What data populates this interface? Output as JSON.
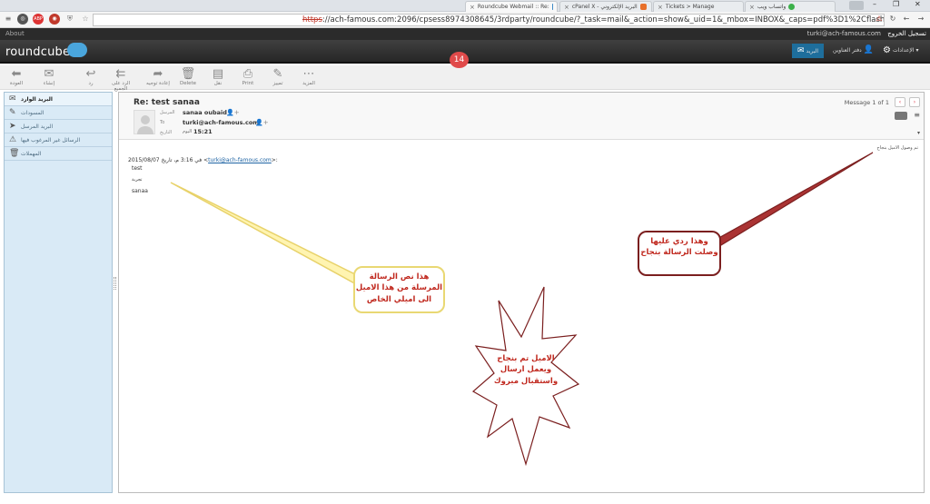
{
  "browser": {
    "tabs": [
      {
        "label": "Roundcube Webmail :: Re:",
        "active": true
      },
      {
        "label": "cPanel X - البريد الإلكتروني",
        "active": false
      },
      {
        "label": "Tickets > Manage",
        "active": false
      },
      {
        "label": "واتساب ويب",
        "active": false
      }
    ],
    "url_scheme": "https",
    "url_rest": "://ach-famous.com:2096/cpsess8974308645/3rdparty/roundcube/?_task=mail&_action=show&_uid=1&_mbox=INBOX&_caps=pdf%3D1%2Cflash%3D1%2Ctif%3D0"
  },
  "topmeta": {
    "about": "About",
    "user_email": "turki@ach-famous.com",
    "logout": "تسجيل الخروج"
  },
  "header": {
    "logo": "roundcube",
    "badge": "14",
    "nav": [
      {
        "label": "البريد",
        "icon": "mail-icon",
        "selected": true
      },
      {
        "label": "دفتر العناوين",
        "icon": "address-book-icon",
        "selected": false
      },
      {
        "label": "الإعدادات",
        "icon": "settings-icon",
        "selected": false
      }
    ]
  },
  "toolbar": {
    "buttons": [
      {
        "label": "العودة",
        "icon": "back-icon",
        "glyph": "⬅"
      },
      {
        "label": "إنشاء",
        "icon": "compose-icon",
        "glyph": "✉"
      },
      {
        "label": "رد",
        "icon": "reply-icon",
        "glyph": "↩"
      },
      {
        "label": "الرد على الجميع",
        "icon": "reply-all-icon",
        "glyph": "⇇"
      },
      {
        "label": "إعادة توجيه",
        "icon": "forward-icon",
        "glyph": "➦"
      },
      {
        "label": "Delete",
        "icon": "delete-icon",
        "glyph": "🗑"
      },
      {
        "label": "نقل",
        "icon": "move-icon",
        "glyph": "▤"
      },
      {
        "label": "Print",
        "icon": "print-icon",
        "glyph": "⎙"
      },
      {
        "label": "تمييز",
        "icon": "mark-icon",
        "glyph": "✎"
      },
      {
        "label": "المزيد",
        "icon": "more-icon",
        "glyph": "⋯"
      }
    ]
  },
  "sidebar": {
    "items": [
      {
        "label": "البريد الوارد",
        "icon": "inbox-icon",
        "glyph": "✉",
        "selected": true
      },
      {
        "label": "المسودات",
        "icon": "drafts-icon",
        "glyph": "✎",
        "selected": false
      },
      {
        "label": "البريد المرسل",
        "icon": "sent-icon",
        "glyph": "➤",
        "selected": false
      },
      {
        "label": "الرسائل غير المرغوب فيها",
        "icon": "junk-icon",
        "glyph": "⚠",
        "selected": false
      },
      {
        "label": "المهملات",
        "icon": "trash-icon",
        "glyph": "🗑",
        "selected": false
      }
    ]
  },
  "message": {
    "subject": "Re: test sanaa",
    "from_label": "المرسل",
    "from": "sanaa oubaid",
    "to_label": "To",
    "to": "turki@ach-famous.com",
    "date_label": "التاريخ",
    "date_prefix": "اليوم",
    "date": "15:21",
    "counter": "Message 1 of 1",
    "reply_line": "تم وصول الاميل بنجاح",
    "quote_header_date": "في 3:16 م، تاريخ 2015/08/07",
    "quote_header_email": "turki@ach-famous.com",
    "quote_lines": [
      "test",
      "تجربة",
      "sanaa"
    ]
  },
  "annotations": {
    "yellow_callout": "هذا نص الرسالة المرسلة من هذا الاميل الى اميلي الخاص",
    "red_callout": "وهذا ردي عليها وصلت الرسالة بنجاح",
    "star_burst": "الاميل تم بنجاح ويعمل ارسال واستقبال مبروك"
  }
}
